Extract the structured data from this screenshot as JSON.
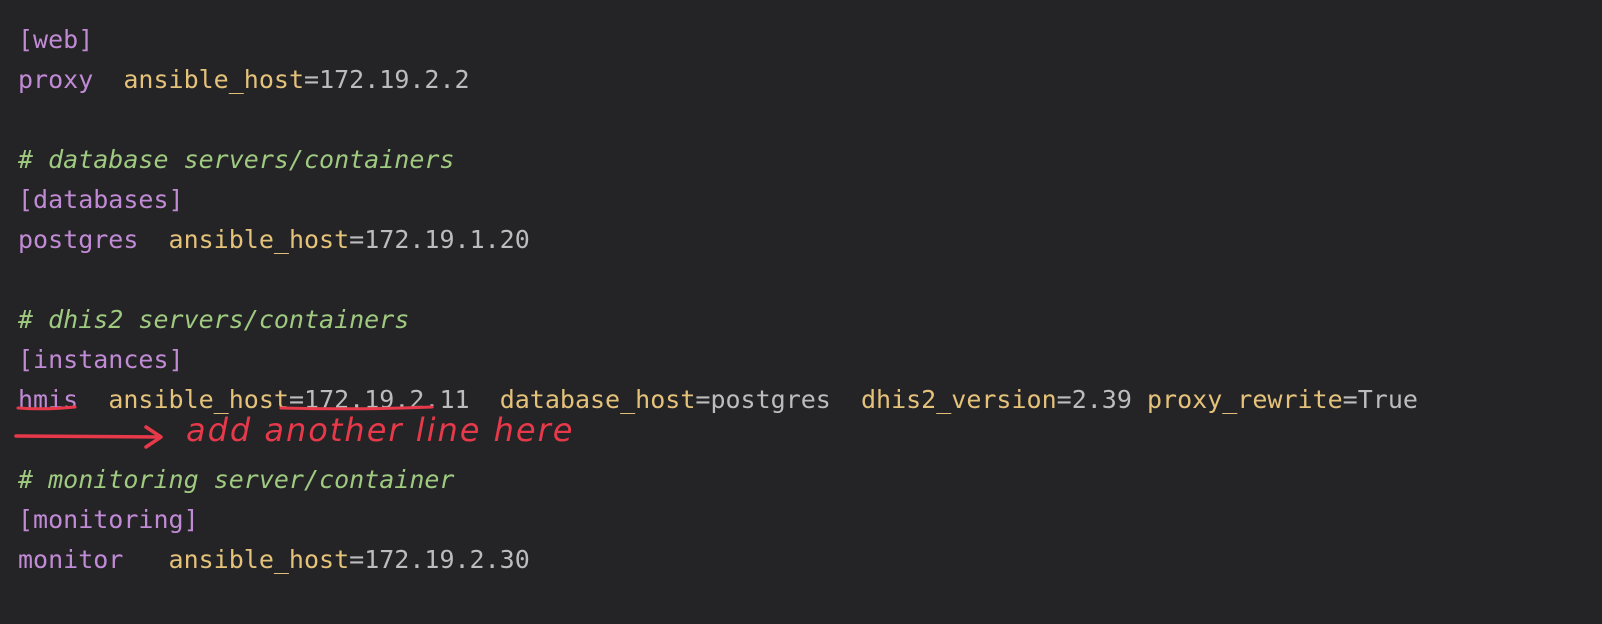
{
  "lines": [
    {
      "type": "section",
      "text": "[web]"
    },
    {
      "type": "host",
      "name": "proxy",
      "pad": "  ",
      "pairs": [
        {
          "key": "ansible_host",
          "value": "172.19.2.2"
        }
      ]
    },
    {
      "type": "blank"
    },
    {
      "type": "comment",
      "text": "# database servers/containers"
    },
    {
      "type": "section",
      "text": "[databases]"
    },
    {
      "type": "host",
      "name": "postgres",
      "pad": "  ",
      "pairs": [
        {
          "key": "ansible_host",
          "value": "172.19.1.20"
        }
      ]
    },
    {
      "type": "blank"
    },
    {
      "type": "comment",
      "text": "# dhis2 servers/containers"
    },
    {
      "type": "section",
      "text": "[instances]"
    },
    {
      "type": "host",
      "name": "hmis",
      "pad": "  ",
      "pairs": [
        {
          "key": "ansible_host",
          "value": "172.19.2.11",
          "sep": "  "
        },
        {
          "key": "database_host",
          "value": "postgres",
          "sep": "  "
        },
        {
          "key": "dhis2_version",
          "value": "2.39",
          "sep": " "
        },
        {
          "key": "proxy_rewrite",
          "value": "True"
        }
      ]
    },
    {
      "type": "blank"
    },
    {
      "type": "comment",
      "text": "# monitoring server/container"
    },
    {
      "type": "section",
      "text": "[monitoring]"
    },
    {
      "type": "host",
      "name": "monitor",
      "pad": "   ",
      "pairs": [
        {
          "key": "ansible_host",
          "value": "172.19.2.30"
        }
      ]
    }
  ],
  "annotation": {
    "text": "add another line here",
    "color": "#e8394a"
  },
  "colors": {
    "background": "#242427",
    "section": "#c08ad4",
    "key": "#e5c27a",
    "value": "#bcbcbc",
    "comment": "#9fca80"
  }
}
